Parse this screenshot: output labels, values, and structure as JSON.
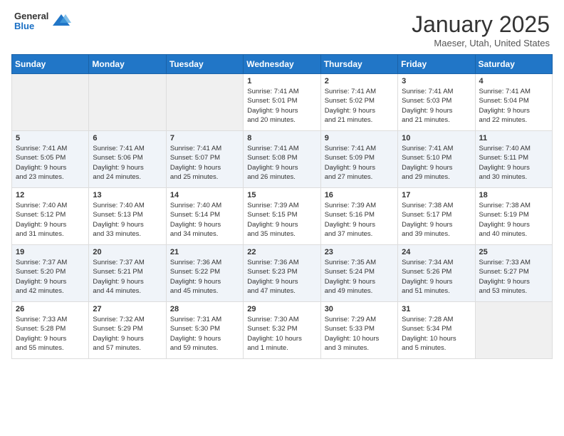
{
  "header": {
    "logo": {
      "line1": "General",
      "line2": "Blue"
    },
    "title": "January 2025",
    "subtitle": "Maeser, Utah, United States"
  },
  "days_of_week": [
    "Sunday",
    "Monday",
    "Tuesday",
    "Wednesday",
    "Thursday",
    "Friday",
    "Saturday"
  ],
  "weeks": [
    [
      {
        "day": "",
        "info": ""
      },
      {
        "day": "",
        "info": ""
      },
      {
        "day": "",
        "info": ""
      },
      {
        "day": "1",
        "info": "Sunrise: 7:41 AM\nSunset: 5:01 PM\nDaylight: 9 hours\nand 20 minutes."
      },
      {
        "day": "2",
        "info": "Sunrise: 7:41 AM\nSunset: 5:02 PM\nDaylight: 9 hours\nand 21 minutes."
      },
      {
        "day": "3",
        "info": "Sunrise: 7:41 AM\nSunset: 5:03 PM\nDaylight: 9 hours\nand 21 minutes."
      },
      {
        "day": "4",
        "info": "Sunrise: 7:41 AM\nSunset: 5:04 PM\nDaylight: 9 hours\nand 22 minutes."
      }
    ],
    [
      {
        "day": "5",
        "info": "Sunrise: 7:41 AM\nSunset: 5:05 PM\nDaylight: 9 hours\nand 23 minutes."
      },
      {
        "day": "6",
        "info": "Sunrise: 7:41 AM\nSunset: 5:06 PM\nDaylight: 9 hours\nand 24 minutes."
      },
      {
        "day": "7",
        "info": "Sunrise: 7:41 AM\nSunset: 5:07 PM\nDaylight: 9 hours\nand 25 minutes."
      },
      {
        "day": "8",
        "info": "Sunrise: 7:41 AM\nSunset: 5:08 PM\nDaylight: 9 hours\nand 26 minutes."
      },
      {
        "day": "9",
        "info": "Sunrise: 7:41 AM\nSunset: 5:09 PM\nDaylight: 9 hours\nand 27 minutes."
      },
      {
        "day": "10",
        "info": "Sunrise: 7:41 AM\nSunset: 5:10 PM\nDaylight: 9 hours\nand 29 minutes."
      },
      {
        "day": "11",
        "info": "Sunrise: 7:40 AM\nSunset: 5:11 PM\nDaylight: 9 hours\nand 30 minutes."
      }
    ],
    [
      {
        "day": "12",
        "info": "Sunrise: 7:40 AM\nSunset: 5:12 PM\nDaylight: 9 hours\nand 31 minutes."
      },
      {
        "day": "13",
        "info": "Sunrise: 7:40 AM\nSunset: 5:13 PM\nDaylight: 9 hours\nand 33 minutes."
      },
      {
        "day": "14",
        "info": "Sunrise: 7:40 AM\nSunset: 5:14 PM\nDaylight: 9 hours\nand 34 minutes."
      },
      {
        "day": "15",
        "info": "Sunrise: 7:39 AM\nSunset: 5:15 PM\nDaylight: 9 hours\nand 35 minutes."
      },
      {
        "day": "16",
        "info": "Sunrise: 7:39 AM\nSunset: 5:16 PM\nDaylight: 9 hours\nand 37 minutes."
      },
      {
        "day": "17",
        "info": "Sunrise: 7:38 AM\nSunset: 5:17 PM\nDaylight: 9 hours\nand 39 minutes."
      },
      {
        "day": "18",
        "info": "Sunrise: 7:38 AM\nSunset: 5:19 PM\nDaylight: 9 hours\nand 40 minutes."
      }
    ],
    [
      {
        "day": "19",
        "info": "Sunrise: 7:37 AM\nSunset: 5:20 PM\nDaylight: 9 hours\nand 42 minutes."
      },
      {
        "day": "20",
        "info": "Sunrise: 7:37 AM\nSunset: 5:21 PM\nDaylight: 9 hours\nand 44 minutes."
      },
      {
        "day": "21",
        "info": "Sunrise: 7:36 AM\nSunset: 5:22 PM\nDaylight: 9 hours\nand 45 minutes."
      },
      {
        "day": "22",
        "info": "Sunrise: 7:36 AM\nSunset: 5:23 PM\nDaylight: 9 hours\nand 47 minutes."
      },
      {
        "day": "23",
        "info": "Sunrise: 7:35 AM\nSunset: 5:24 PM\nDaylight: 9 hours\nand 49 minutes."
      },
      {
        "day": "24",
        "info": "Sunrise: 7:34 AM\nSunset: 5:26 PM\nDaylight: 9 hours\nand 51 minutes."
      },
      {
        "day": "25",
        "info": "Sunrise: 7:33 AM\nSunset: 5:27 PM\nDaylight: 9 hours\nand 53 minutes."
      }
    ],
    [
      {
        "day": "26",
        "info": "Sunrise: 7:33 AM\nSunset: 5:28 PM\nDaylight: 9 hours\nand 55 minutes."
      },
      {
        "day": "27",
        "info": "Sunrise: 7:32 AM\nSunset: 5:29 PM\nDaylight: 9 hours\nand 57 minutes."
      },
      {
        "day": "28",
        "info": "Sunrise: 7:31 AM\nSunset: 5:30 PM\nDaylight: 9 hours\nand 59 minutes."
      },
      {
        "day": "29",
        "info": "Sunrise: 7:30 AM\nSunset: 5:32 PM\nDaylight: 10 hours\nand 1 minute."
      },
      {
        "day": "30",
        "info": "Sunrise: 7:29 AM\nSunset: 5:33 PM\nDaylight: 10 hours\nand 3 minutes."
      },
      {
        "day": "31",
        "info": "Sunrise: 7:28 AM\nSunset: 5:34 PM\nDaylight: 10 hours\nand 5 minutes."
      },
      {
        "day": "",
        "info": ""
      }
    ]
  ]
}
